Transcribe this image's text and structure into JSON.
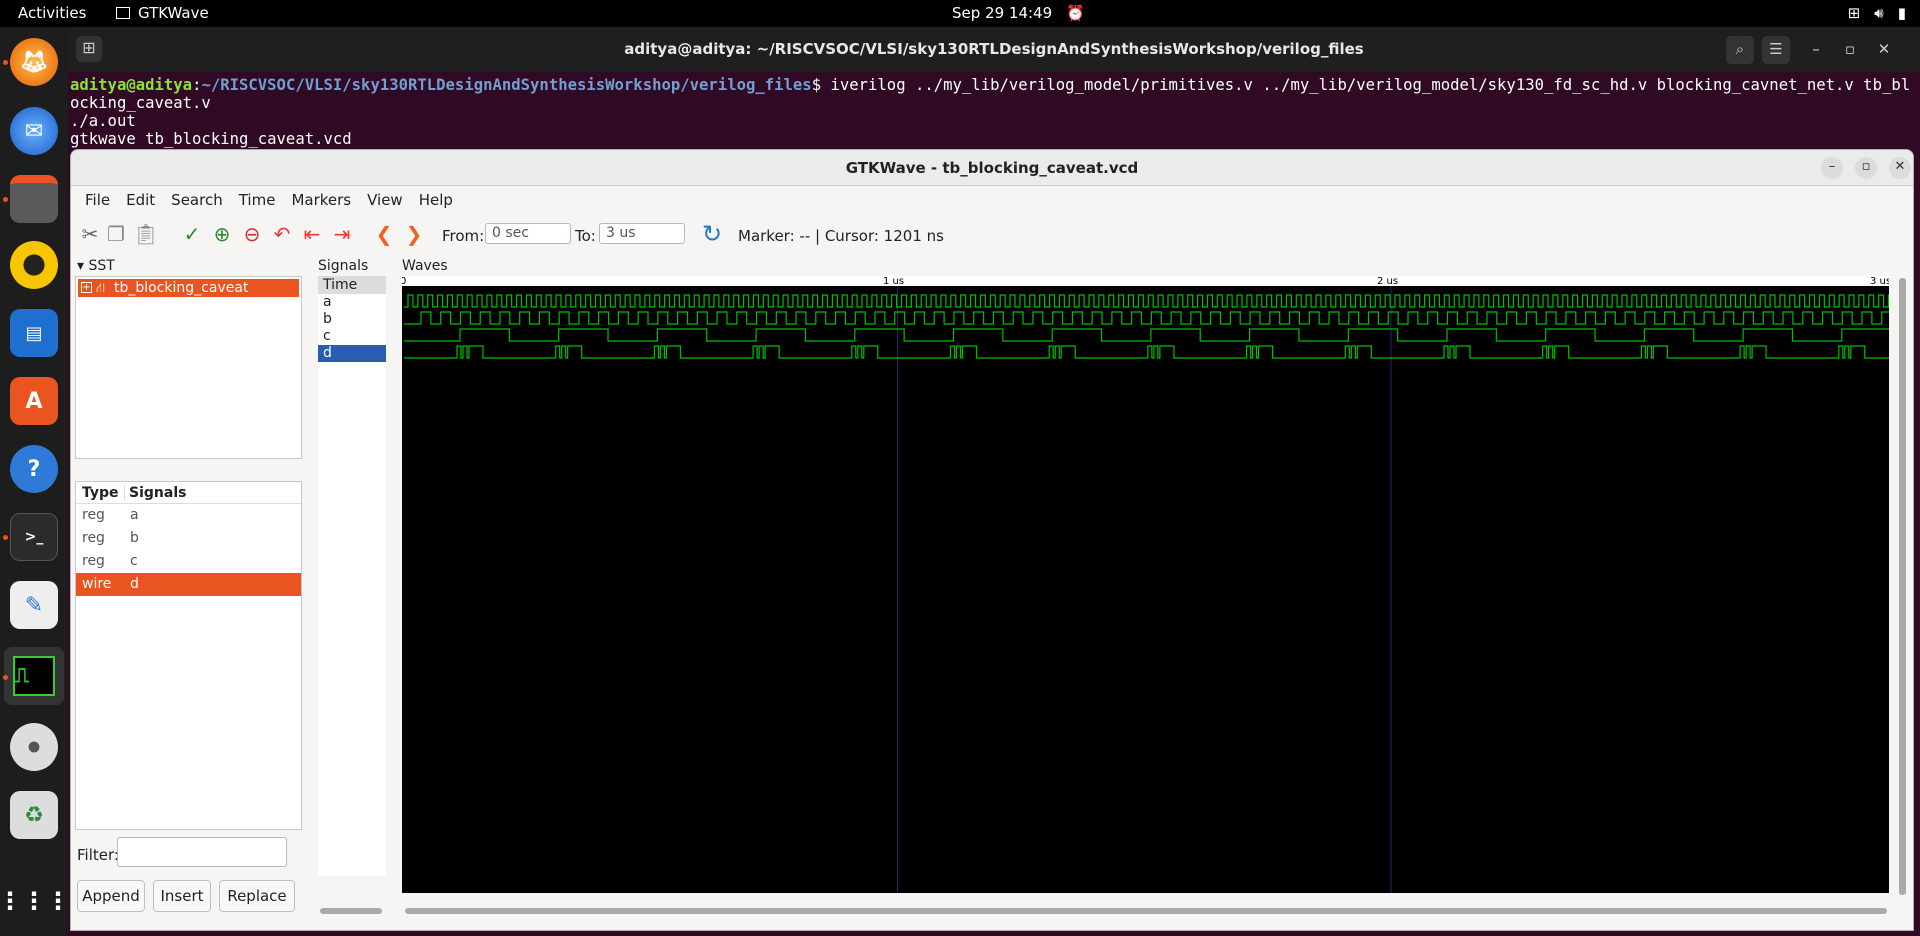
{
  "topbar": {
    "activities": "Activities",
    "app_name": "GTKWave",
    "datetime": "Sep 29  14:49"
  },
  "dock": {
    "items": [
      "firefox-icon",
      "thunderbird-icon",
      "files-icon",
      "rhythmbox-icon",
      "writer-icon",
      "app-center-icon",
      "help-icon",
      "terminal-icon",
      "text-editor-icon",
      "gtkwave-icon",
      "disc-icon",
      "trash-icon",
      "app-grid-icon"
    ]
  },
  "terminal": {
    "title": "aditya@aditya: ~/RISCVSOC/VLSI/sky130RTLDesignAndSynthesisWorkshop/verilog_files",
    "prompt_user": "aditya@aditya",
    "prompt_path": "~/RISCVSOC/VLSI/sky130RTLDesignAndSynthesisWorkshop/verilog_files",
    "command1": "$ iverilog ../my_lib/verilog_model/primitives.v ../my_lib/verilog_model/sky130_fd_sc_hd.v blocking_cavnet_net.v tb_blocking_caveat.v",
    "line2": "./a.out",
    "line3": "gtkwave tb_blocking_caveat.vcd"
  },
  "gtkwave": {
    "title": "GTKWave - tb_blocking_caveat.vcd",
    "menu": [
      "File",
      "Edit",
      "Search",
      "Time",
      "Markers",
      "View",
      "Help"
    ],
    "from_label": "From:",
    "from_value": "0 sec",
    "to_label": "To:",
    "to_value": "3 us",
    "marker_text": "Marker: -- | Cursor: 1201 ns",
    "sst_label": "SST",
    "tree_root": "tb_blocking_caveat",
    "sig_table_headers": {
      "type": "Type",
      "signals": "Signals"
    },
    "sig_table_rows": [
      {
        "type": "reg",
        "name": "a"
      },
      {
        "type": "reg",
        "name": "b"
      },
      {
        "type": "reg",
        "name": "c"
      },
      {
        "type": "wire",
        "name": "d"
      }
    ],
    "filter_label": "Filter:",
    "buttons": {
      "append": "Append",
      "insert": "Insert",
      "replace": "Replace"
    },
    "signals_label": "Signals",
    "signals": [
      "Time",
      "a",
      "b",
      "c",
      "d"
    ],
    "waves_label": "Waves",
    "time_ticks": [
      "0",
      "1 us",
      "2 us",
      "3 us"
    ],
    "wave_color": "#00c000",
    "accent_color": "#e95420"
  }
}
